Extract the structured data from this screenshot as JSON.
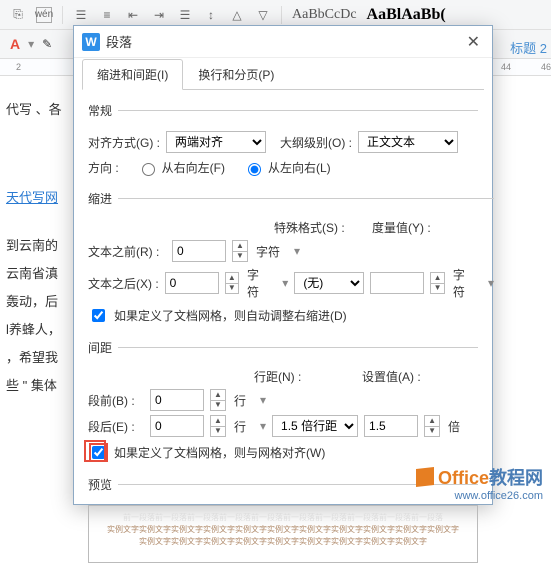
{
  "toolbar": {
    "icons": [
      "copy",
      "wen",
      "list-bullet",
      "list-number",
      "indent-left",
      "indent-right",
      "text-left",
      "line-spacing",
      "ruler-a",
      "ruler-b"
    ],
    "style_preview1": "AaBbCcDc",
    "style_preview2": "AaBlAaBb(",
    "heading_label": "标题 2"
  },
  "ruler_marks": [
    "2",
    "",
    "",
    "",
    "",
    "",
    "",
    "",
    "",
    "",
    "",
    "",
    "",
    "",
    "",
    "",
    "",
    "",
    "44",
    "46"
  ],
  "doc_lines": {
    "l1": "代写 、各",
    "l2": "天代写网",
    "l3": "到云南的",
    "l4": "云南省滇",
    "l5": "轰动，后",
    "l6": "l养蜂人，",
    "l7": "，希望我",
    "l8": "些 \" 集体"
  },
  "dialog": {
    "title": "段落",
    "tabs": {
      "t1": "缩进和间距(I)",
      "t2": "换行和分页(P)"
    },
    "section_general": "常规",
    "align_label": "对齐方式(G) :",
    "align_value": "两端对齐",
    "outline_label": "大纲级别(O) :",
    "outline_value": "正文文本",
    "direction_label": "方向 :",
    "dir_rtl": "从右向左(F)",
    "dir_ltr": "从左向右(L)",
    "section_indent": "缩进",
    "indent_before_label": "文本之前(R) :",
    "indent_before_value": "0",
    "indent_after_label": "文本之后(X) :",
    "indent_after_value": "0",
    "unit_char": "字符",
    "special_label": "特殊格式(S) :",
    "special_value": "(无)",
    "measure_label": "度量值(Y) :",
    "measure_value": "",
    "chk_indent": "如果定义了文档网格，则自动调整右缩进(D)",
    "section_spacing": "间距",
    "space_before_label": "段前(B) :",
    "space_before_value": "0",
    "space_after_label": "段后(E) :",
    "space_after_value": "0",
    "unit_line": "行",
    "line_spacing_label": "行距(N) :",
    "line_spacing_value": "1.5 倍行距",
    "set_value_label": "设置值(A) :",
    "set_value_value": "1.5",
    "unit_times": "倍",
    "chk_grid": "如果定义了文档网格，则与网格对齐(W)",
    "section_preview": "预览",
    "preview_faint": "前一段落前一段落前一段落前一段落前一段落前一段落前一段落前一段落前一段落前一段落",
    "preview_text": "实例文字实例文字实例文字实例文字实例文字实例文字实例文字实例文字实例文字实例文字实例文字实例文字实例文字实例文字实例文字实例文字实例文字实例文字实例文字实例文字"
  },
  "brand": {
    "name1": "Office",
    "name2": "教程网",
    "url": "www.office26.com"
  }
}
